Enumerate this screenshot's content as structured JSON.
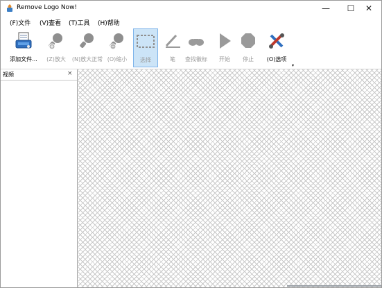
{
  "window": {
    "title": "Remove Logo Now!",
    "controls": {
      "minimize": "—",
      "maximize": "☐",
      "close": "✕"
    }
  },
  "menu": [
    {
      "label": "(F)文件"
    },
    {
      "label": "(V)查看"
    },
    {
      "label": "(T)工具"
    },
    {
      "label": "(H)帮助"
    }
  ],
  "toolbar": {
    "add_file": "添加文件...",
    "zoom_in": "(Z)放大",
    "zoom_normal": "(N)放大正常",
    "zoom_out": "(O)缩小",
    "select": "选择",
    "pen": "笔",
    "find_logo": "查找徽标",
    "start": "开始",
    "stop": "停止",
    "options": "(O)选项",
    "overflow": "▾"
  },
  "video_pane": {
    "title": "视频",
    "close": "×"
  },
  "colors": {
    "selected_bg": "#cce4f7",
    "selected_border": "#7eb4ea",
    "disabled": "#9a9a9a"
  }
}
